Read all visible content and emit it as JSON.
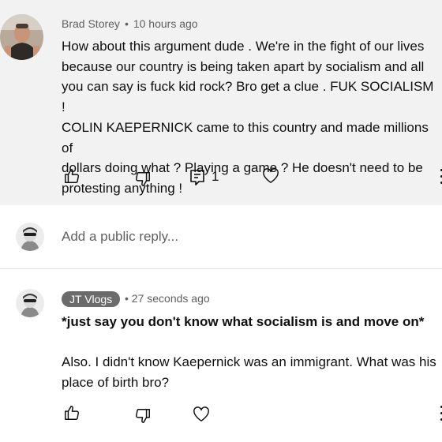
{
  "parent_comment": {
    "author": "Brad Storey",
    "separator": "•",
    "time": "10 hours ago",
    "lines": [
      "How about this argument dude . We're in the fight of our lives",
      "because our country is being taken apart by socialism and all",
      "you can say is fuck kid rock? Bro get a clue . FUK SOCIALISM !",
      "COLIN KAEPERNICK came to this country and made millions of",
      "dollars doing what ? Playing a game ? He doesn't need to be",
      "protesting anything !"
    ],
    "reply_count": "1",
    "icons": [
      "thumbs-up-icon",
      "thumbs-down-icon",
      "reply-icon",
      "heart-icon",
      "more-vert-icon"
    ]
  },
  "reply_input": {
    "placeholder": "Add a public reply..."
  },
  "reply_comment": {
    "author": "JT Vlogs",
    "separator": "•",
    "time": "27 seconds ago",
    "line_bold": "*just say you don't know what socialism is and move on*",
    "lines": [
      "Also. I didn't know Kaepernick was an immigrant. What was his",
      "place of birth bro?"
    ],
    "icons": [
      "thumbs-up-icon",
      "thumbs-down-icon",
      "heart-icon",
      "more-vert-icon"
    ]
  },
  "colors": {
    "parent_background": "#f2f2f2",
    "author_chip_background": "#6b6b6b",
    "secondary_text": "#606060"
  }
}
